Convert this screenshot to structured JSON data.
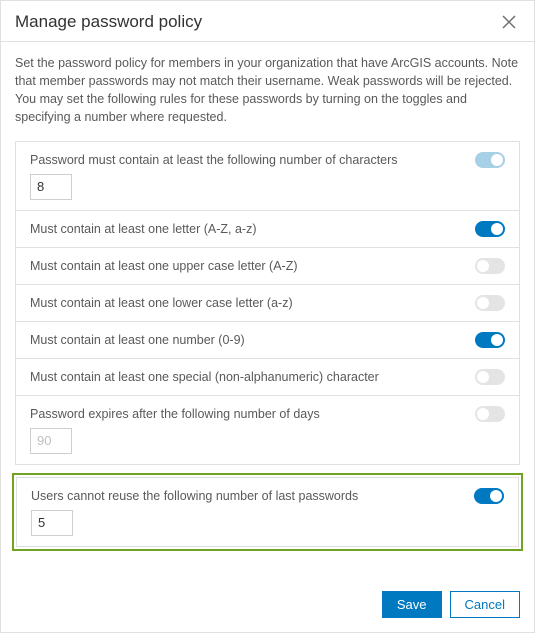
{
  "header": {
    "title": "Manage password policy"
  },
  "intro": "Set the password policy for members in your organization that have ArcGIS accounts. Note that member passwords may not match their username. Weak passwords will be rejected. You may set the following rules for these passwords by turning on the toggles and specifying a number where requested.",
  "rules": [
    {
      "label": "Password must contain at least the following number of characters",
      "on": true,
      "muted": true,
      "input": "8"
    },
    {
      "label": "Must contain at least one letter (A-Z, a-z)",
      "on": true
    },
    {
      "label": "Must contain at least one upper case letter (A-Z)",
      "on": false
    },
    {
      "label": "Must contain at least one lower case letter (a-z)",
      "on": false
    },
    {
      "label": "Must contain at least one number (0-9)",
      "on": true
    },
    {
      "label": "Must contain at least one special (non-alphanumeric) character",
      "on": false
    },
    {
      "label": "Password expires after the following number of days",
      "on": false,
      "input": "90",
      "inputDisabled": true
    }
  ],
  "highlighted_rule": {
    "label": "Users cannot reuse the following number of last passwords",
    "on": true,
    "input": "5"
  },
  "footer": {
    "save": "Save",
    "cancel": "Cancel"
  }
}
